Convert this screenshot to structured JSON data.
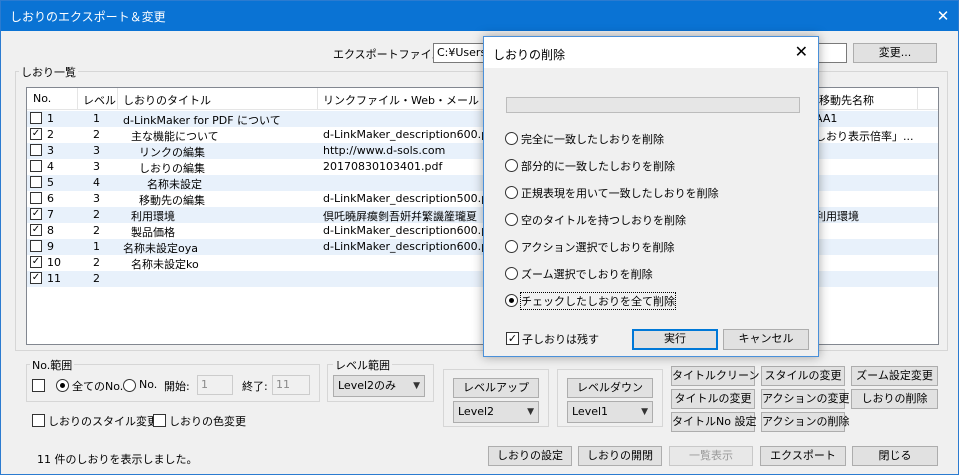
{
  "window": {
    "title": "しおりのエクスポート＆変更",
    "close": "✕"
  },
  "export_file": {
    "label": "エクスポートファイル:",
    "value": "C:¥Users¥",
    "change_button": "変更..."
  },
  "bookmark_group_title": "しおり一覧",
  "list": {
    "columns": [
      "No.",
      "レベル",
      "しおりのタイトル",
      "リンクファイル・Web・メール",
      "移動先名称"
    ],
    "rows": [
      {
        "checked": false,
        "no": "1",
        "level": "1",
        "title": "d-LinkMaker for PDF について",
        "indent": 0,
        "link": "",
        "dest": "AA1"
      },
      {
        "checked": true,
        "no": "2",
        "level": "2",
        "title": "主な機能について",
        "indent": 1,
        "link": "d-LinkMaker_description600.pdf",
        "dest": "しおり表示倍率」..."
      },
      {
        "checked": false,
        "no": "3",
        "level": "3",
        "title": "リンクの編集",
        "indent": 2,
        "link": "http://www.d-sols.com",
        "dest": ""
      },
      {
        "checked": false,
        "no": "4",
        "level": "3",
        "title": "しおりの編集",
        "indent": 2,
        "link": "20170830103401.pdf",
        "dest": ""
      },
      {
        "checked": false,
        "no": "5",
        "level": "4",
        "title": "名称未設定",
        "indent": 3,
        "link": "",
        "dest": ""
      },
      {
        "checked": false,
        "no": "6",
        "level": "3",
        "title": "移動先の編集",
        "indent": 2,
        "link": "d-LinkMaker_description500.pdf",
        "dest": ""
      },
      {
        "checked": true,
        "no": "7",
        "level": "2",
        "title": "利用環境",
        "indent": 1,
        "link": "倶吒曉屛瘼剼吾姸幷繁譏簅瓏夏",
        "dest": "利用環境"
      },
      {
        "checked": true,
        "no": "8",
        "level": "2",
        "title": "製品価格",
        "indent": 1,
        "link": "d-LinkMaker_description600.pdf",
        "dest": ""
      },
      {
        "checked": false,
        "no": "9",
        "level": "1",
        "title": "名称未設定oya",
        "indent": 0,
        "link": "d-LinkMaker_description600.pdf",
        "dest": ""
      },
      {
        "checked": true,
        "no": "10",
        "level": "2",
        "title": "名称未設定ko",
        "indent": 1,
        "link": "",
        "dest": ""
      },
      {
        "checked": true,
        "no": "11",
        "level": "2",
        "title": "",
        "indent": 1,
        "link": "",
        "dest": ""
      }
    ]
  },
  "no_range": {
    "title": "No.範囲",
    "all": "全てのNo.",
    "no": "No.",
    "start_label": "開始:",
    "start_value": "1",
    "end_label": "終了:",
    "end_value": "11"
  },
  "level_range": {
    "title": "レベル範囲",
    "selected": "Level2のみ"
  },
  "level_up": {
    "button": "レベルアップ",
    "selected": "Level2"
  },
  "level_down": {
    "button": "レベルダウン",
    "selected": "Level1"
  },
  "options": {
    "style_change": "しおりのスタイル変更",
    "color_change": "しおりの色変更"
  },
  "actions": {
    "title_clean": "タイトルクリーン",
    "style_change": "スタイルの変更",
    "zoom_change": "ズーム設定変更",
    "title_change": "タイトルの変更",
    "action_change": "アクションの変更",
    "bookmark_delete": "しおりの削除",
    "title_no": "タイトルNo 設定",
    "action_delete": "アクションの削除"
  },
  "status": "11 件のしおりを表示しました。",
  "footer": {
    "settings": "しおりの設定",
    "open_close": "しおりの開閉",
    "list_view": "一覧表示",
    "export": "エクスポート",
    "close": "閉じる"
  },
  "dialog": {
    "title": "しおりの削除",
    "close": "✕",
    "options": [
      "完全に一致したしおりを削除",
      "部分的に一致したしおりを削除",
      "正規表現を用いて一致したしおりを削除",
      "空のタイトルを持つしおりを削除",
      "アクション選択でしおりを削除",
      "ズーム選択でしおりを削除",
      "チェックしたしおりを全て削除"
    ],
    "selected_index": 6,
    "keep_children": "子しおりは残す",
    "run": "実行",
    "cancel": "キャンセル"
  }
}
